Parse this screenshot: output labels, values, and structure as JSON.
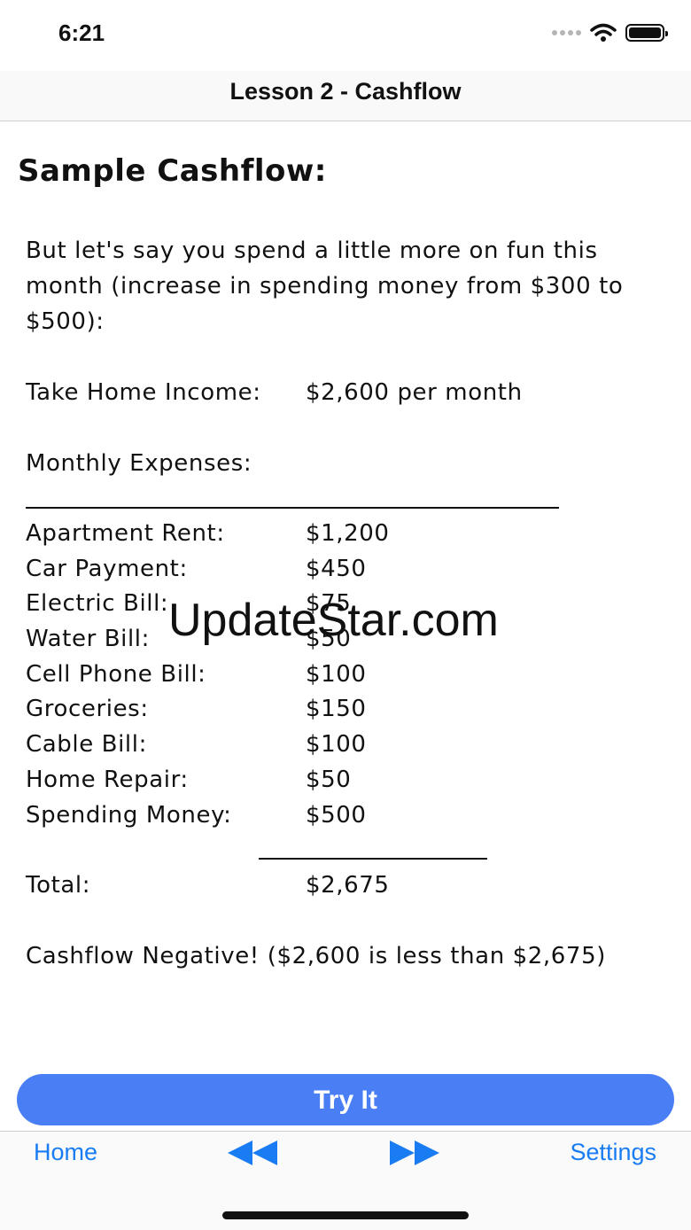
{
  "status": {
    "time": "6:21"
  },
  "nav": {
    "title": "Lesson 2 - Cashflow"
  },
  "content": {
    "heading": "Sample Cashflow:",
    "intro": "But let's say you spend a little more on fun this month (increase in spending money from $300 to $500):",
    "income": {
      "label": "Take Home Income:",
      "value": "$2,600 per month"
    },
    "expenses_label": "Monthly Expenses:",
    "expenses": [
      {
        "label": "Apartment Rent:",
        "value": "$1,200"
      },
      {
        "label": "Car Payment:",
        "value": "$450"
      },
      {
        "label": "Electric Bill:",
        "value": "$75"
      },
      {
        "label": "Water Bill:",
        "value": "$50"
      },
      {
        "label": "Cell Phone Bill:",
        "value": "$100"
      },
      {
        "label": "Groceries:",
        "value": "$150"
      },
      {
        "label": "Cable Bill:",
        "value": "$100"
      },
      {
        "label": "Home Repair:",
        "value": "$50"
      },
      {
        "label": "Spending Money:",
        "value": "$500"
      }
    ],
    "total": {
      "label": "Total:",
      "value": "$2,675"
    },
    "note": "Cashflow Negative! ($2,600 is less than $2,675)"
  },
  "watermark": "UpdateStar.com",
  "try_button": "Try It",
  "toolbar": {
    "home": "Home",
    "back_icon": "rewind-icon",
    "forward_icon": "fast-forward-icon",
    "settings": "Settings"
  },
  "colors": {
    "accent": "#1a7cf2",
    "button": "#4a7ef5"
  }
}
